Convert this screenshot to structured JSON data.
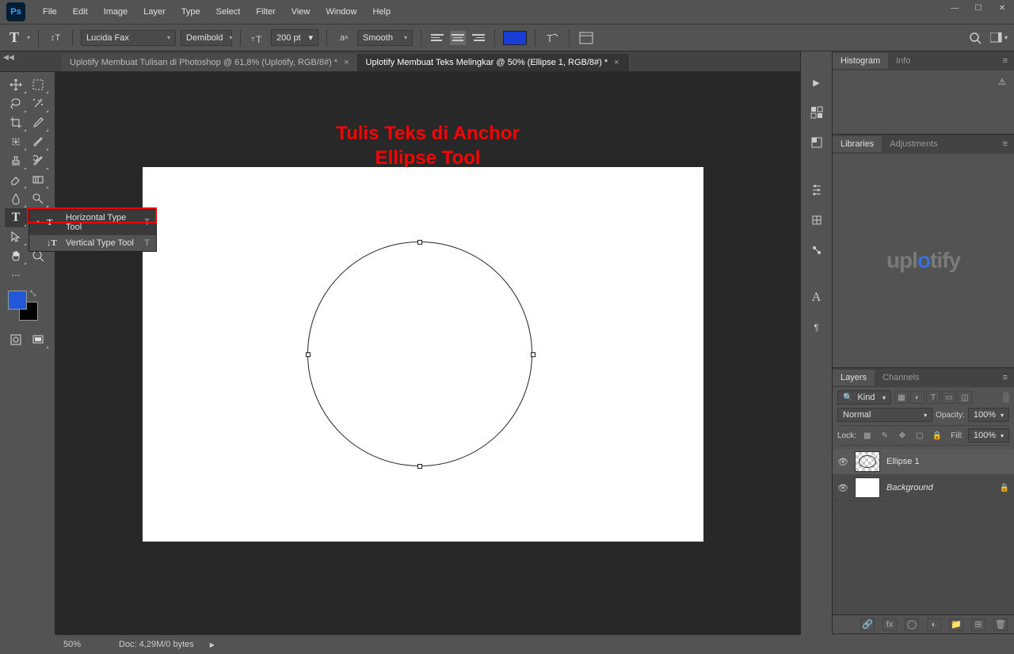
{
  "app": {
    "logo": "Ps"
  },
  "menu": [
    "File",
    "Edit",
    "Image",
    "Layer",
    "Type",
    "Select",
    "Filter",
    "View",
    "Window",
    "Help"
  ],
  "options": {
    "font_family": "Lucida Fax",
    "font_style": "Demibold",
    "font_size": "200 pt",
    "antialias": "Smooth",
    "color": "#1a3dd8"
  },
  "tabs": [
    {
      "title": "Uplotify Membuat Tulisan di Photoshop @ 61,8% (Uplotify, RGB/8#) *",
      "active": false
    },
    {
      "title": "Uplotify Membuat Teks Melingkar @ 50% (Ellipse 1, RGB/8#) *",
      "active": true
    }
  ],
  "annotation": {
    "line1": "Tulis Teks di Anchor",
    "line2": "Ellipse Tool"
  },
  "flyout": {
    "items": [
      {
        "label": "Horizontal Type Tool",
        "shortcut": "T",
        "selected": true
      },
      {
        "label": "Vertical Type Tool",
        "shortcut": "T",
        "selected": false
      }
    ]
  },
  "panels": {
    "histogram": {
      "tabs": [
        "Histogram",
        "Info"
      ],
      "active": 0
    },
    "libraries": {
      "tabs": [
        "Libraries",
        "Adjustments"
      ],
      "active": 0,
      "watermark": "uplotify"
    },
    "layers": {
      "tabs": [
        "Layers",
        "Channels"
      ],
      "active": 0,
      "filter_kind": "Kind",
      "blend_mode": "Normal",
      "opacity_label": "Opacity:",
      "opacity_value": "100%",
      "lock_label": "Lock:",
      "fill_label": "Fill:",
      "fill_value": "100%",
      "items": [
        {
          "name": "Ellipse 1",
          "locked": false,
          "italic": false
        },
        {
          "name": "Background",
          "locked": true,
          "italic": true
        }
      ]
    }
  },
  "status": {
    "zoom": "50%",
    "doc_info": "Doc: 4,29M/0 bytes"
  }
}
